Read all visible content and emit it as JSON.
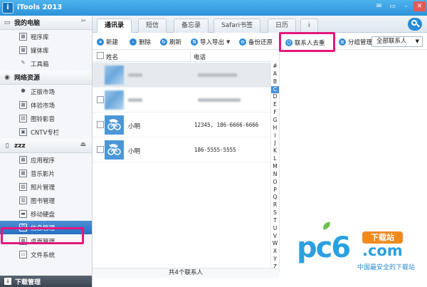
{
  "window": {
    "title": "iTools 2013",
    "logo_letter": "i",
    "controls": [
      "✉",
      "▭",
      "–",
      "✕"
    ]
  },
  "sidebar": {
    "sections": [
      {
        "title": "我的电脑",
        "items": [
          "程序库",
          "媒体库",
          "工具箱"
        ]
      },
      {
        "title": "网络资源",
        "items": [
          "正版市场",
          "体验市场",
          "图铃影音",
          "CNTV专栏"
        ]
      },
      {
        "title": "zzz",
        "items": [
          "应用程序",
          "音乐影片",
          "照片管理",
          "图书管理",
          "移动硬盘",
          "信息管理",
          "桌面管理",
          "文件系统"
        ]
      }
    ],
    "active_item": "信息管理",
    "bottom": "下载管理"
  },
  "tabs": [
    "通讯录",
    "短信",
    "备忘录",
    "Safari书签",
    "日历",
    "i"
  ],
  "active_tab": "通讯录",
  "toolbar": {
    "new": "新建",
    "delete": "删除",
    "refresh": "刷新",
    "import_export": "导入导出",
    "backup_restore": "备份还原",
    "dedup": "联系人去重",
    "group_manage": "分组管理",
    "filter": "全部联系人"
  },
  "columns": {
    "name": "姓名",
    "phone": "电话"
  },
  "contacts": [
    {
      "name": "小明",
      "phone": "12345, 186-6666-6666"
    },
    {
      "name": "小明",
      "phone": "186-5555-5555"
    }
  ],
  "alphabet": [
    "#",
    "A",
    "B",
    "C",
    "D",
    "E",
    "F",
    "G",
    "H",
    "I",
    "J",
    "K",
    "L",
    "M",
    "N",
    "O",
    "P",
    "Q",
    "R",
    "S",
    "T",
    "U",
    "V",
    "W",
    "X",
    "Y",
    "Z"
  ],
  "active_letter": "C",
  "status": "共4个联系人",
  "watermark": {
    "brand": "pc6",
    "download": "下载站",
    "domain": ".com",
    "slogan": "中国最安全的下载站"
  },
  "colors": {
    "accent": "#2a8ad8",
    "highlight": "#e4177c",
    "active": "#2a6fbf"
  }
}
